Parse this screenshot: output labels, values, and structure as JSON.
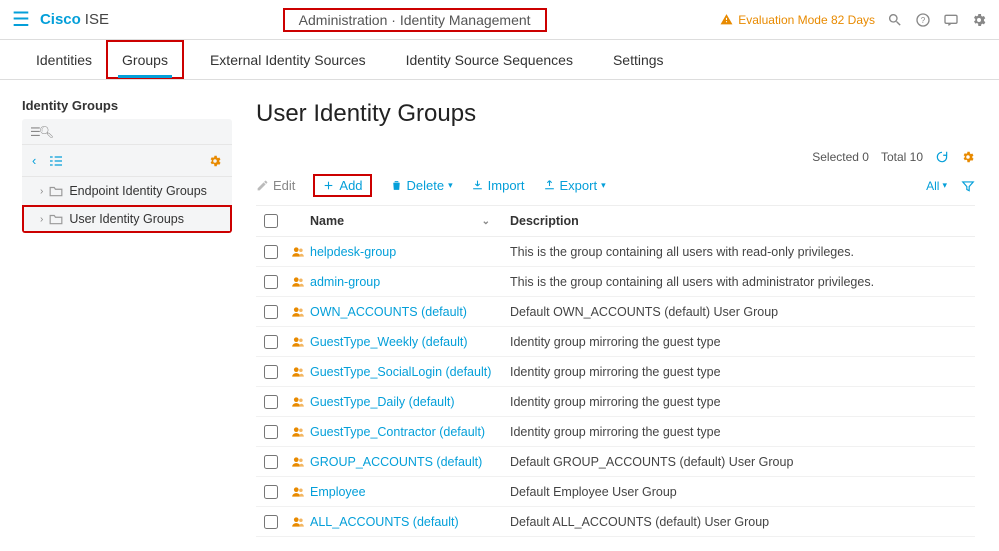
{
  "header": {
    "brand": "Cisco",
    "product": "ISE",
    "breadcrumb": "Administration · Identity Management",
    "eval_text": "Evaluation Mode 82 Days"
  },
  "tabs": [
    {
      "label": "Identities",
      "active": false,
      "highlight": false
    },
    {
      "label": "Groups",
      "active": true,
      "highlight": true
    },
    {
      "label": "External Identity Sources",
      "active": false,
      "highlight": false
    },
    {
      "label": "Identity Source Sequences",
      "active": false,
      "highlight": false
    },
    {
      "label": "Settings",
      "active": false,
      "highlight": false
    }
  ],
  "sidebar": {
    "title": "Identity Groups",
    "search_placeholder": "",
    "tree": [
      {
        "label": "Endpoint Identity Groups",
        "highlight": false
      },
      {
        "label": "User Identity Groups",
        "highlight": true
      }
    ]
  },
  "page": {
    "title": "User Identity Groups",
    "selected_label": "Selected 0",
    "total_label": "Total 10"
  },
  "toolbar": {
    "edit": "Edit",
    "add": "Add",
    "delete": "Delete",
    "import": "Import",
    "export": "Export",
    "all": "All"
  },
  "columns": {
    "name": "Name",
    "description": "Description"
  },
  "rows": [
    {
      "name": "helpdesk-group",
      "description": "This is the group containing all users with read-only privileges."
    },
    {
      "name": "admin-group",
      "description": "This is the group containing all users with administrator privileges."
    },
    {
      "name": "OWN_ACCOUNTS (default)",
      "description": "Default OWN_ACCOUNTS (default) User Group"
    },
    {
      "name": "GuestType_Weekly (default)",
      "description": "Identity group mirroring the guest type"
    },
    {
      "name": "GuestType_SocialLogin (default)",
      "description": "Identity group mirroring the guest type"
    },
    {
      "name": "GuestType_Daily (default)",
      "description": "Identity group mirroring the guest type"
    },
    {
      "name": "GuestType_Contractor (default)",
      "description": "Identity group mirroring the guest type"
    },
    {
      "name": "GROUP_ACCOUNTS (default)",
      "description": "Default GROUP_ACCOUNTS (default) User Group"
    },
    {
      "name": "Employee",
      "description": "Default Employee User Group"
    },
    {
      "name": "ALL_ACCOUNTS (default)",
      "description": "Default ALL_ACCOUNTS (default) User Group"
    }
  ]
}
